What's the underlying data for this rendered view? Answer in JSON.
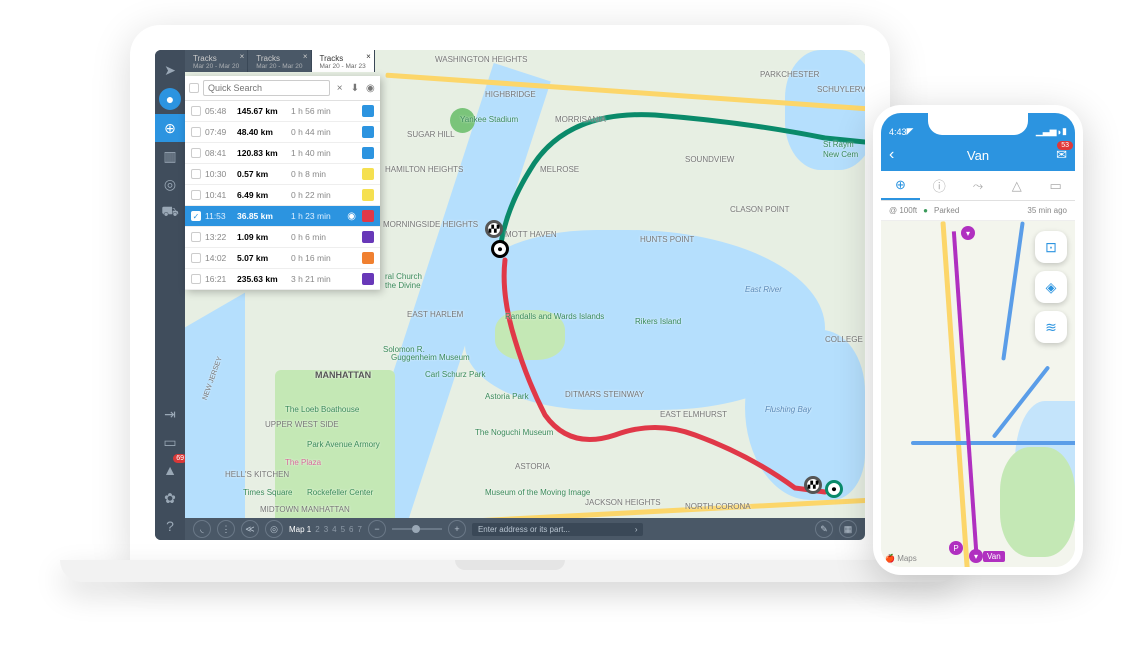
{
  "sidebar": {
    "notification_badge": "69"
  },
  "tabs": [
    {
      "label": "Tracks",
      "range": "Mar 20 - Mar 20"
    },
    {
      "label": "Tracks",
      "range": "Mar 20 - Mar 20"
    },
    {
      "label": "Tracks",
      "range": "Mar 20 - Mar 23"
    }
  ],
  "search": {
    "placeholder": "Quick Search"
  },
  "tracks": [
    {
      "time": "05:48",
      "dist": "145.67 km",
      "dur": "1 h 56 min",
      "color": "#2c94e0",
      "selected": false
    },
    {
      "time": "07:49",
      "dist": "48.40 km",
      "dur": "0 h 44 min",
      "color": "#2c94e0",
      "selected": false
    },
    {
      "time": "08:41",
      "dist": "120.83 km",
      "dur": "1 h 40 min",
      "color": "#2c94e0",
      "selected": false
    },
    {
      "time": "10:30",
      "dist": "0.57 km",
      "dur": "0 h 8 min",
      "color": "#f5e050",
      "selected": false
    },
    {
      "time": "10:41",
      "dist": "6.49 km",
      "dur": "0 h 22 min",
      "color": "#f5e050",
      "selected": false
    },
    {
      "time": "11:53",
      "dist": "36.85 km",
      "dur": "1 h 23 min",
      "color": "#e03848",
      "selected": true
    },
    {
      "time": "13:22",
      "dist": "1.09 km",
      "dur": "0 h 6 min",
      "color": "#6838b8",
      "selected": false
    },
    {
      "time": "14:02",
      "dist": "5.07 km",
      "dur": "0 h 16 min",
      "color": "#f08030",
      "selected": false
    },
    {
      "time": "16:21",
      "dist": "235.63 km",
      "dur": "3 h 21 min",
      "color": "#6838b8",
      "selected": false
    }
  ],
  "bottombar": {
    "map_label": "Map 1",
    "pages": [
      "2",
      "3",
      "4",
      "5",
      "6",
      "7"
    ],
    "address_placeholder": "Enter address or its part..."
  },
  "map_labels": {
    "washington_heights": "WASHINGTON HEIGHTS",
    "highbridge": "HIGHBRIDGE",
    "parkchester": "PARKCHESTER",
    "schuylerville": "SCHUYLERVILLE",
    "yankee": "Yankee Stadium",
    "morrisania": "MORRISANIA",
    "sugar_hill": "SUGAR HILL",
    "melrose": "MELROSE",
    "soundview": "SOUNDVIEW",
    "clason": "CLASON POINT",
    "hamilton": "HAMILTON HEIGHTS",
    "morningside": "MORNINGSIDE HEIGHTS",
    "mott": "MOTT HAVEN",
    "hunts": "HUNTS POINT",
    "east_harlem": "EAST HARLEM",
    "randalls": "Randalls and Wards Islands",
    "rikers": "Rikers Island",
    "college": "COLLEGE",
    "manhattan": "MANHATTAN",
    "upper_west": "UPPER WEST SIDE",
    "carl": "Carl Schurz Park",
    "ditmars": "DITMARS STEINWAY",
    "east_elmhurst": "EAST ELMHURST",
    "flushing": "Flushing Bay",
    "east_river": "East River",
    "loeb": "The Loeb Boathouse",
    "guggenheim": "Guggenheim Museum",
    "noguchi": "The Noguchi Museum",
    "astoria_park": "Astoria Park",
    "park_ave": "Park Avenue Armory",
    "plaza": "The Plaza",
    "hells": "HELL'S KITCHEN",
    "astoria": "ASTORIA",
    "jackson": "JACKSON HEIGHTS",
    "north_corona": "NORTH CORONA",
    "times": "Times Square",
    "rockefeller": "Rockefeller Center",
    "midtown": "MIDTOWN MANHATTAN",
    "moving": "Museum of the Moving Image",
    "st_raym": "St Raym",
    "new_cem": "New Cem",
    "solomon": "Solomon R.",
    "cathedral": "ral Church",
    "divine": "the Divine",
    "new_jersey": "NEW JERSEY"
  },
  "phone": {
    "status_time": "4:43",
    "header": "Van",
    "mail_badge": "53",
    "info_dist": "@ 100ft",
    "info_status": "Parked",
    "info_time": "35 min ago",
    "marker_p": "P",
    "unit_label": "Van",
    "maps_attr": "Maps"
  }
}
